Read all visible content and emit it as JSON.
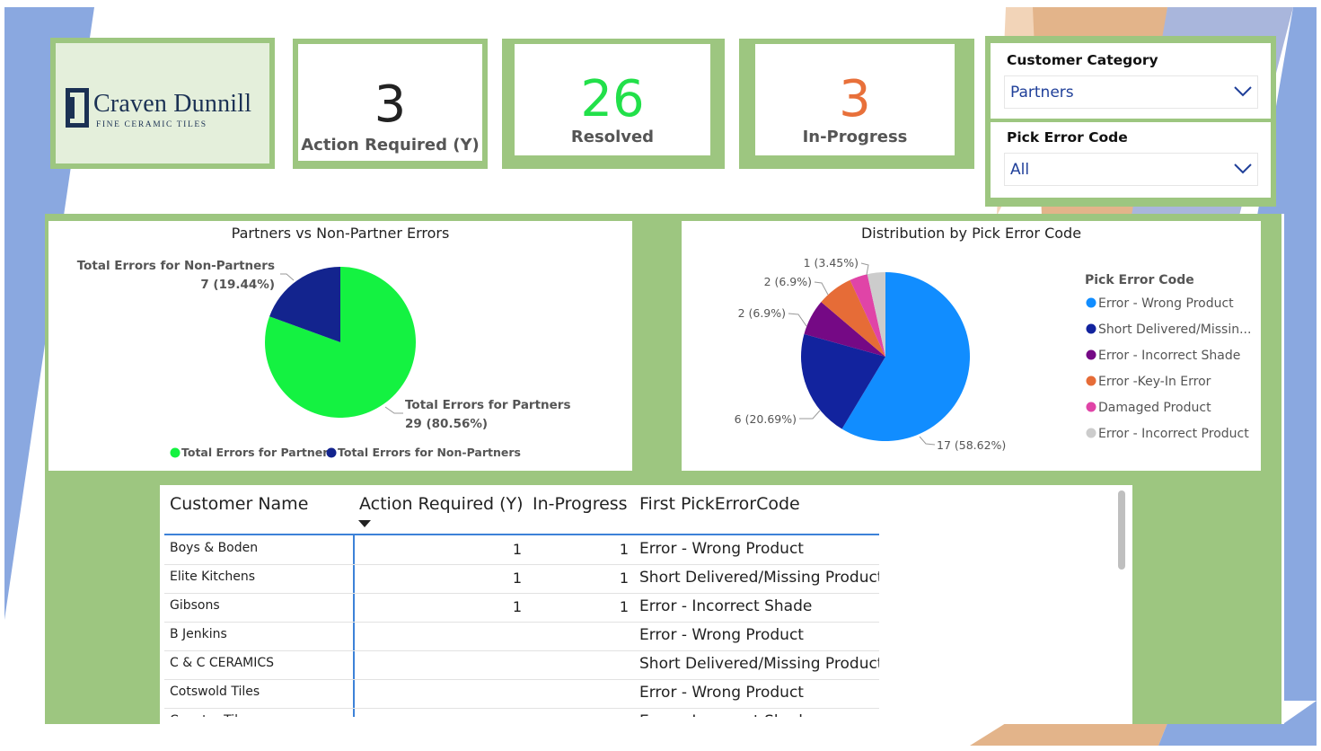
{
  "brand": {
    "name": "Craven Dunnill",
    "tagline": "FINE CERAMIC TILES"
  },
  "kpis": {
    "action_required": {
      "value": "3",
      "label": "Action Required (Y)",
      "color": "#222222"
    },
    "resolved": {
      "value": "26",
      "label": "Resolved",
      "color": "#22e04a"
    },
    "in_progress": {
      "value": "3",
      "label": "In-Progress",
      "color": "#e8703a"
    }
  },
  "slicers": {
    "customer_category": {
      "title": "Customer Category",
      "value": "Partners"
    },
    "pick_error_code": {
      "title": "Pick Error Code",
      "value": "All"
    }
  },
  "colors": {
    "panel_green": "#9dc680",
    "partners_green": "#14f241",
    "non_partners_navy": "#13248e",
    "wrong_product": "#118dff",
    "short_delivered": "#12239e",
    "incorrect_shade": "#750985",
    "key_in_error": "#e66c37",
    "damaged_product": "#e044a7",
    "incorrect_product": "#cccccc"
  },
  "chart_data": [
    {
      "type": "pie",
      "title": "Partners vs Non-Partner Errors",
      "labels": [
        "Total Errors for Partners",
        "Total Errors for Non-Partners"
      ],
      "values": [
        29,
        7
      ],
      "data_labels": [
        {
          "name": "Total Errors for Partners",
          "value": "29 (80.56%)"
        },
        {
          "name": "Total Errors for Non-Partners",
          "value": "7 (19.44%)"
        }
      ],
      "legend": [
        "Total Errors for Partners",
        "Total Errors for Non-Partners"
      ],
      "legend_position": "bottom"
    },
    {
      "type": "pie",
      "title": "Distribution by Pick Error Code",
      "legend_title": "Pick Error Code",
      "legend_position": "right",
      "labels": [
        "Error - Wrong Product",
        "Short Delivered/Missin...",
        "Error - Incorrect Shade",
        "Error -Key-In Error",
        "Damaged Product",
        "Error - Incorrect Product"
      ],
      "values": [
        17,
        6,
        2,
        2,
        1,
        1
      ],
      "data_labels": [
        "17 (58.62%)",
        "6 (20.69%)",
        "2 (6.9%)",
        "2 (6.9%)",
        "1 (3.45%)",
        "1 (3.45%)"
      ]
    }
  ],
  "table": {
    "columns": [
      "Customer Name",
      "Action Required (Y)",
      "In-Progress",
      "First PickErrorCode"
    ],
    "rows": [
      {
        "customer": "Boys & Boden",
        "action": "1",
        "progress": "1",
        "code": "Error - Wrong Product"
      },
      {
        "customer": "Elite Kitchens",
        "action": "1",
        "progress": "1",
        "code": "Short Delivered/Missing Product"
      },
      {
        "customer": "Gibsons",
        "action": "1",
        "progress": "1",
        "code": "Error - Incorrect Shade"
      },
      {
        "customer": "B Jenkins",
        "action": "",
        "progress": "",
        "code": "Error - Wrong Product"
      },
      {
        "customer": "C & C CERAMICS",
        "action": "",
        "progress": "",
        "code": "Short Delivered/Missing Product"
      },
      {
        "customer": "Cotswold Tiles",
        "action": "",
        "progress": "",
        "code": "Error - Wrong Product"
      },
      {
        "customer": "Country Tiles",
        "action": "",
        "progress": "",
        "code": "Error - Incorrect Shade"
      }
    ]
  }
}
